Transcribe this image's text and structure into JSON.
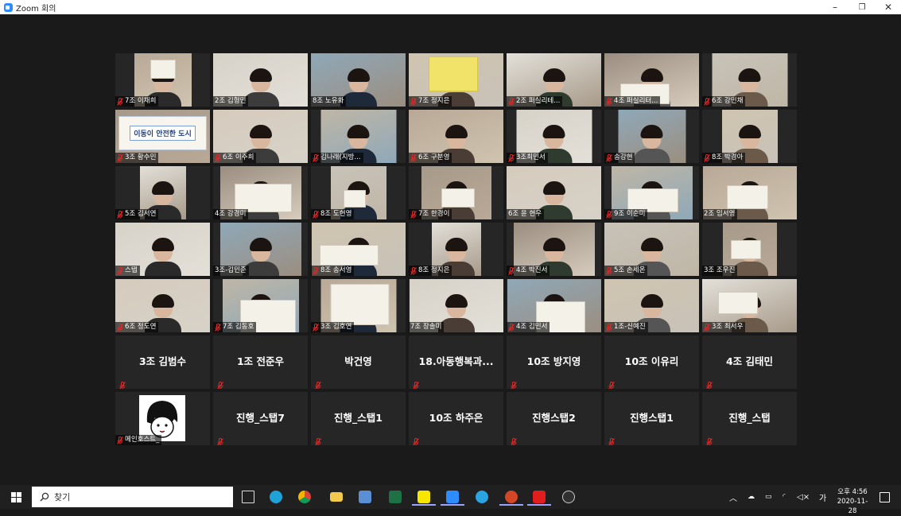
{
  "window": {
    "title": "Zoom 회의"
  },
  "window_controls": {
    "minimize": "–",
    "restore": "❐",
    "close": "✕"
  },
  "colors": {
    "stage": "#1a1a1a",
    "tile": "#262626",
    "muted_mic": "#e02828",
    "zoom_blue": "#2d8cff"
  },
  "participants": [
    {
      "name": "7조 이채희",
      "muted": true
    },
    {
      "name": "2조 김형민",
      "muted": false
    },
    {
      "name": "8조 노유화",
      "muted": false
    },
    {
      "name": "7조 정지은",
      "muted": true
    },
    {
      "name": "2조 퍼실리테...",
      "muted": true
    },
    {
      "name": "4조 퍼실리터...",
      "muted": true
    },
    {
      "name": "6조 강민채",
      "muted": true
    },
    {
      "name": "3조 황수민",
      "muted": true,
      "sign": "이동이 안전한 도시"
    },
    {
      "name": "6조 이주희",
      "muted": true
    },
    {
      "name": "김나래(지방...",
      "muted": true
    },
    {
      "name": "6조 구분영",
      "muted": true
    },
    {
      "name": "3조최민서",
      "muted": true
    },
    {
      "name": "송강현",
      "muted": true
    },
    {
      "name": "8조 박경아",
      "muted": true
    },
    {
      "name": "5조 김서연",
      "muted": true
    },
    {
      "name": "4조 강경미",
      "muted": false
    },
    {
      "name": "8조 도현영",
      "muted": true
    },
    {
      "name": "7조 한경이",
      "muted": true
    },
    {
      "name": "6조 윤 현우",
      "muted": false
    },
    {
      "name": "9조 이순미",
      "muted": true
    },
    {
      "name": "2조 임서영",
      "muted": false
    },
    {
      "name": "스탭",
      "muted": true
    },
    {
      "name": "3조-김민준",
      "muted": false
    },
    {
      "name": "8조 송서영",
      "muted": true
    },
    {
      "name": "8조 정지은",
      "muted": true
    },
    {
      "name": "4조 박진서",
      "muted": true
    },
    {
      "name": "5조 손세온",
      "muted": true
    },
    {
      "name": "3조 조우진",
      "muted": false
    },
    {
      "name": "6조 정도연",
      "muted": true
    },
    {
      "name": "7조 김동호",
      "muted": true
    },
    {
      "name": "3조 김호연",
      "muted": true
    },
    {
      "name": "7조 장솔미",
      "muted": false
    },
    {
      "name": "4조 김민서",
      "muted": true
    },
    {
      "name": "1조-신예진",
      "muted": true
    },
    {
      "name": "3조 최서우",
      "muted": true
    }
  ],
  "text_tiles": [
    {
      "name": "3조 김범수"
    },
    {
      "name": "1조 전준우"
    },
    {
      "name": "박건영"
    },
    {
      "name": "18.아동행복과..."
    },
    {
      "name": "10조 방지영"
    },
    {
      "name": "10조 이유리"
    },
    {
      "name": "4조 김태민"
    },
    {
      "name": "메인호스트_",
      "avatar": true
    },
    {
      "name": "진행_스탭7"
    },
    {
      "name": "진행_스탭1"
    },
    {
      "name": "10조 하주은"
    },
    {
      "name": "진행스탭2"
    },
    {
      "name": "진행스탭1"
    },
    {
      "name": "진행_스탭"
    }
  ],
  "taskbar": {
    "search_placeholder": "찾기",
    "tray_ime": "가",
    "clock_time": "오후 4:56",
    "clock_date": "2020-11-28"
  }
}
